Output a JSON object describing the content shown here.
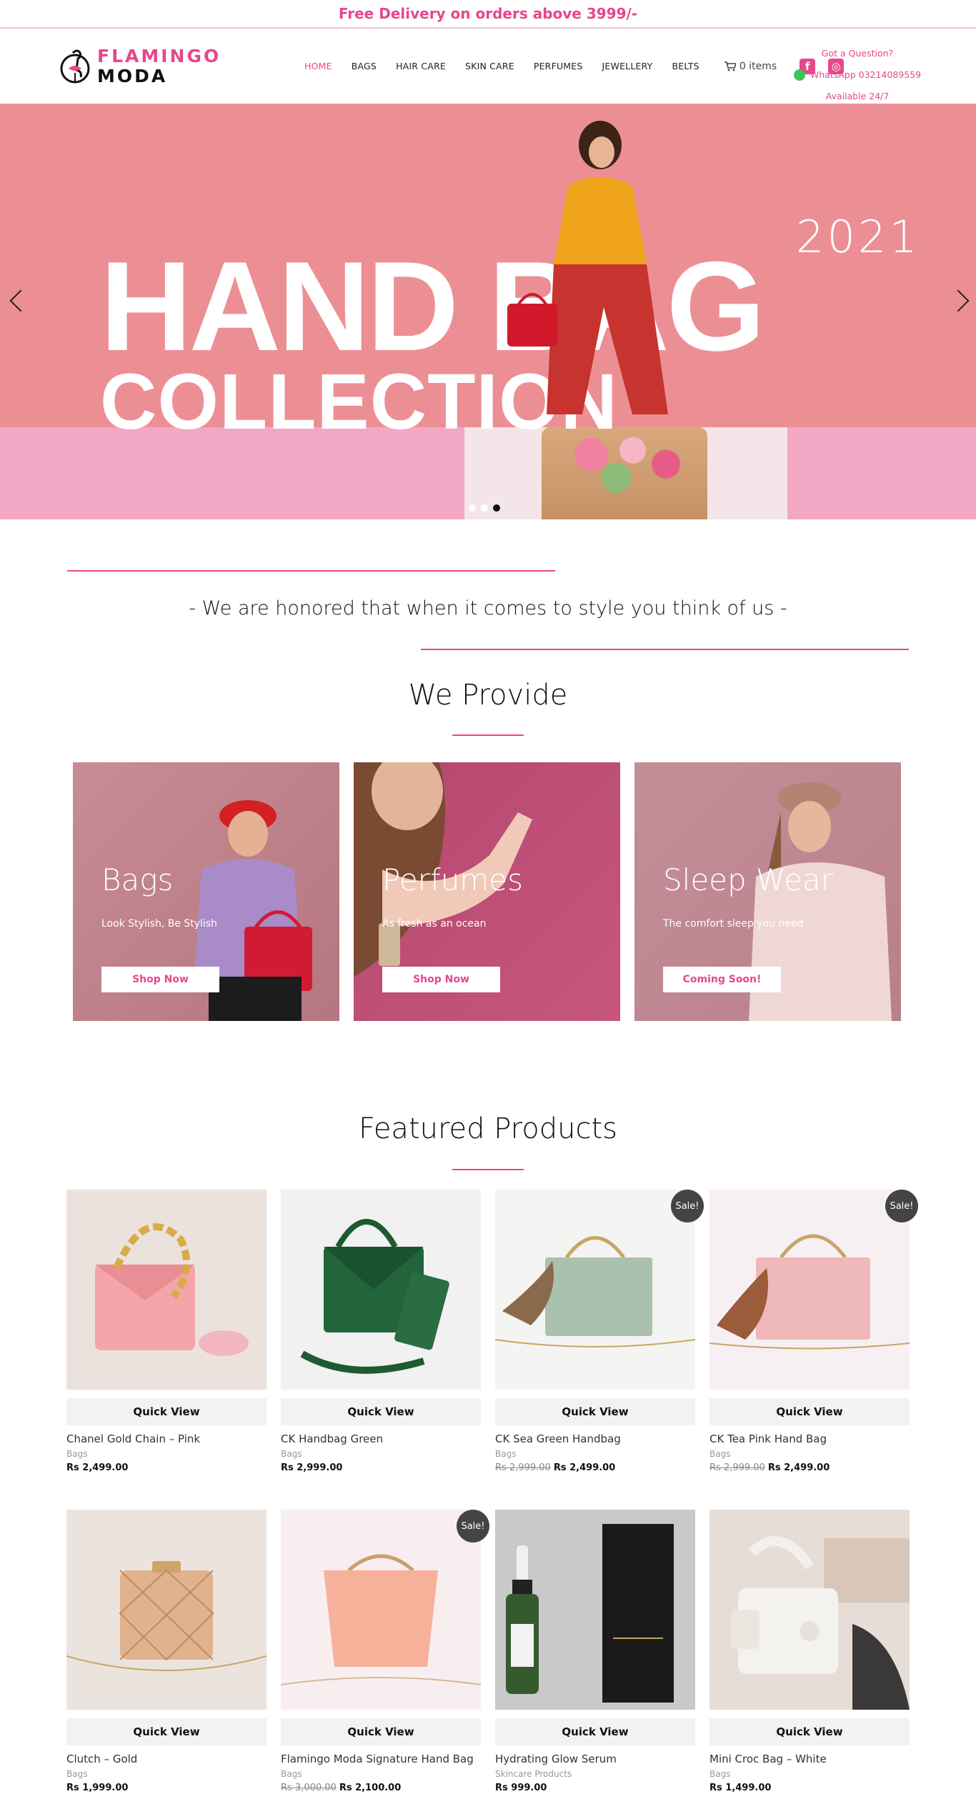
{
  "topbar": {
    "text": "Free Delivery on orders above 3999/-"
  },
  "brand": {
    "line1": "FLAMINGO",
    "line2": "MODA"
  },
  "nav": [
    {
      "label": "HOME"
    },
    {
      "label": "BAGS"
    },
    {
      "label": "HAIR CARE"
    },
    {
      "label": "SKIN CARE"
    },
    {
      "label": "PERFUMES"
    },
    {
      "label": "JEWELLERY"
    },
    {
      "label": "BELTS"
    }
  ],
  "cart": {
    "label": "0 items"
  },
  "social": {
    "facebook": "f",
    "instagram": "◎"
  },
  "contact": {
    "question": "Got a Question?",
    "whatsapp": "WhatsApp 03214089559",
    "availability": "Available 24/7"
  },
  "hero": {
    "line1": "HAND BAG",
    "line2": "COLLECTION",
    "year": "2021",
    "slides": 3,
    "active_slide": 3
  },
  "tagline": "- We are honored that when it comes to style you think of us -",
  "provide": {
    "title": "We Provide",
    "cards": [
      {
        "title": "Bags",
        "subtitle": "Look Stylish, Be Stylish",
        "button": "Shop Now"
      },
      {
        "title": "Perfumes",
        "subtitle": "As fresh as an ocean",
        "button": "Shop Now"
      },
      {
        "title": "Sleep Wear",
        "subtitle": "The comfort sleep you need",
        "button": "Coming Soon!"
      }
    ]
  },
  "featured": {
    "title": "Featured Products",
    "quick_view": "Quick View",
    "sale_badge": "Sale!",
    "products": [
      {
        "name": "Chanel Gold Chain – Pink",
        "category": "Bags",
        "old_price": "",
        "price": "Rs 2,499.00",
        "sale": false
      },
      {
        "name": "CK Handbag Green",
        "category": "Bags",
        "old_price": "",
        "price": "Rs 2,999.00",
        "sale": false
      },
      {
        "name": "CK Sea Green Handbag",
        "category": "Bags",
        "old_price": "Rs 2,999.00",
        "price": "Rs 2,499.00",
        "sale": true
      },
      {
        "name": "CK Tea Pink Hand Bag",
        "category": "Bags",
        "old_price": "Rs 2,999.00",
        "price": "Rs 2,499.00",
        "sale": true
      },
      {
        "name": "Clutch – Gold",
        "category": "Bags",
        "old_price": "",
        "price": "Rs 1,999.00",
        "sale": false
      },
      {
        "name": "Flamingo Moda Signature Hand Bag",
        "category": "Bags",
        "old_price": "Rs 3,000.00",
        "price": "Rs 2,100.00",
        "sale": true
      },
      {
        "name": "Hydrating Glow Serum",
        "category": "Skincare Products",
        "old_price": "",
        "price": "Rs 999.00",
        "sale": false
      },
      {
        "name": "Mini Croc Bag – White",
        "category": "Bags",
        "old_price": "",
        "price": "Rs 1,499.00",
        "sale": false
      }
    ]
  },
  "colors": {
    "accent": "#e8468d",
    "hero_bg": "#ec8f94"
  }
}
